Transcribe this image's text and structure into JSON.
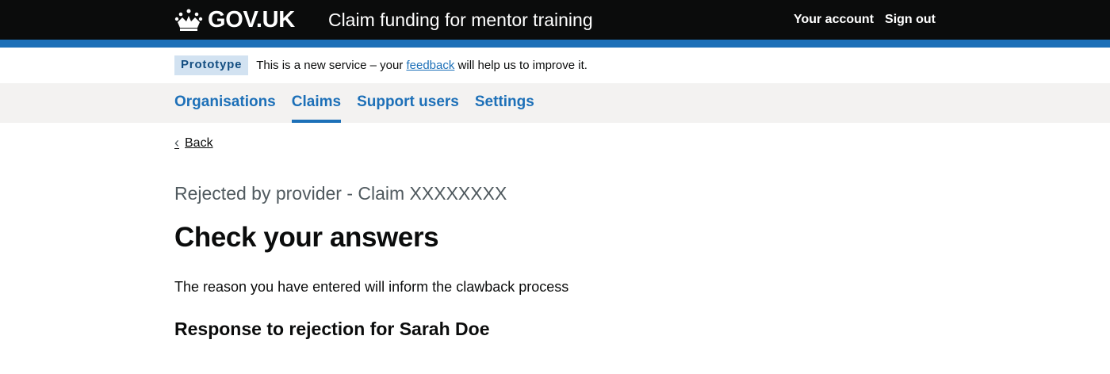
{
  "header": {
    "logo_text": "GOV.UK",
    "service_name": "Claim funding for mentor training",
    "account_link": "Your account",
    "signout_link": "Sign out"
  },
  "phase_banner": {
    "tag": "Prototype",
    "text_before": "This is a new service – your ",
    "link": "feedback",
    "text_after": " will help us to improve it."
  },
  "nav": {
    "items": [
      {
        "label": "Organisations",
        "active": false
      },
      {
        "label": "Claims",
        "active": true
      },
      {
        "label": "Support users",
        "active": false
      },
      {
        "label": "Settings",
        "active": false
      }
    ]
  },
  "main": {
    "back_label": "Back",
    "caption": "Rejected by provider - Claim XXXXXXXX",
    "heading": "Check your answers",
    "body": "The reason you have entered will inform the clawback process",
    "subheading": "Response to rejection for Sarah Doe"
  },
  "colors": {
    "header_bg": "#0b0c0c",
    "brand_blue": "#1d70b8",
    "nav_bg": "#f3f2f1",
    "tag_bg": "#d2e2f1"
  },
  "icons": {
    "logo": "crown-icon",
    "back": "chevron-left-icon"
  }
}
